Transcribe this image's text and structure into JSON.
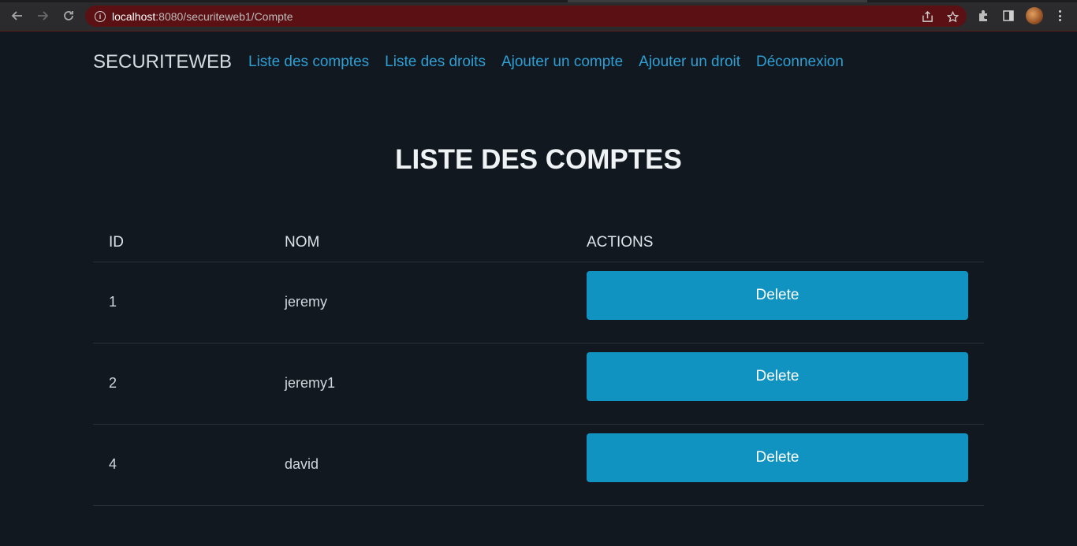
{
  "browser": {
    "url_host": "localhost",
    "url_rest": ":8080/securiteweb1/Compte"
  },
  "navbar": {
    "brand": "SECURITEWEB",
    "links": [
      {
        "label": "Liste des comptes"
      },
      {
        "label": "Liste des droits"
      },
      {
        "label": "Ajouter un compte"
      },
      {
        "label": "Ajouter un droit"
      },
      {
        "label": "Déconnexion"
      }
    ]
  },
  "page": {
    "title": "LISTE DES COMPTES"
  },
  "table": {
    "headers": {
      "id": "ID",
      "nom": "NOM",
      "actions": "ACTIONS"
    },
    "rows": [
      {
        "id": "1",
        "nom": "jeremy",
        "action": "Delete"
      },
      {
        "id": "2",
        "nom": "jeremy1",
        "action": "Delete"
      },
      {
        "id": "4",
        "nom": "david",
        "action": "Delete"
      }
    ]
  },
  "colors": {
    "background": "#121820",
    "link": "#2e9fd3",
    "button": "#1193c1",
    "omnibox": "#5b1013"
  },
  "icons": [
    "back-arrow-icon",
    "forward-arrow-icon",
    "reload-icon",
    "info-icon",
    "share-icon",
    "star-icon",
    "extensions-icon",
    "side-panel-icon",
    "profile-avatar",
    "menu-kebab-icon"
  ]
}
